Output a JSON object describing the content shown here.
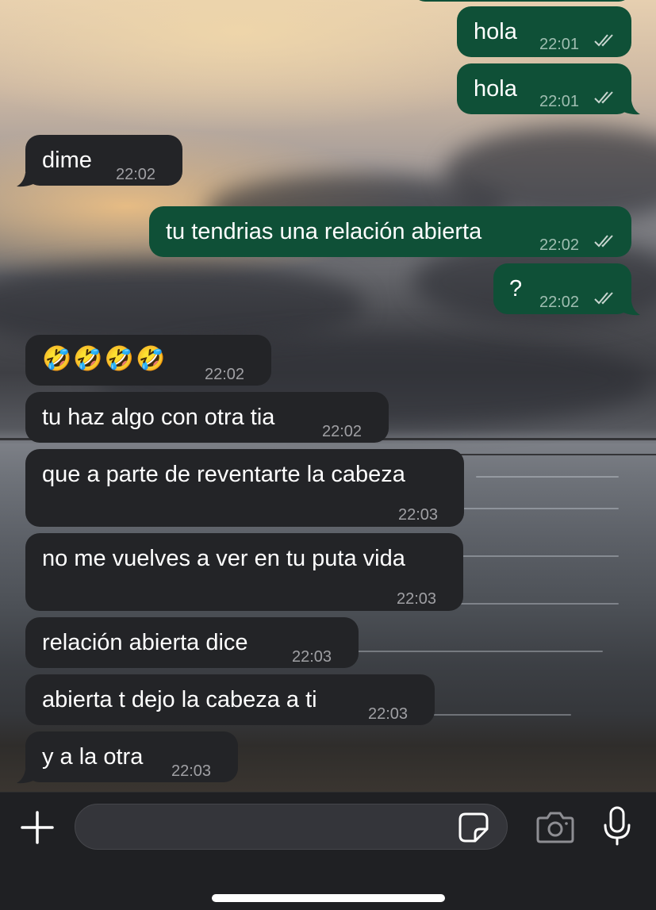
{
  "chat": {
    "messages": [
      {
        "direction": "out",
        "text": "hola",
        "time": "22:01",
        "status": "read"
      },
      {
        "direction": "out",
        "text": "hola",
        "time": "22:01",
        "status": "read"
      },
      {
        "direction": "in",
        "text": "dime",
        "time": "22:02"
      },
      {
        "direction": "out",
        "text": "tu tendrias una relación abierta",
        "time": "22:02",
        "status": "read"
      },
      {
        "direction": "out",
        "text": "?",
        "time": "22:02",
        "status": "read"
      },
      {
        "direction": "in",
        "text": "🤣🤣🤣🤣",
        "time": "22:02"
      },
      {
        "direction": "in",
        "text": "tu haz algo con otra tia",
        "time": "22:02"
      },
      {
        "direction": "in",
        "text": "que a parte de reventarte la cabeza",
        "time": "22:03"
      },
      {
        "direction": "in",
        "text": "no me vuelves a ver en tu puta vida",
        "time": "22:03"
      },
      {
        "direction": "in",
        "text": "relación abierta dice",
        "time": "22:03"
      },
      {
        "direction": "in",
        "text": "abierta t dejo la cabeza a ti",
        "time": "22:03"
      },
      {
        "direction": "in",
        "text": "y a la otra",
        "time": "22:03"
      }
    ]
  },
  "composer": {
    "placeholder": "",
    "icons": [
      "plus-icon",
      "sticker-icon",
      "camera-icon",
      "mic-icon"
    ]
  },
  "colors": {
    "outgoing_bubble": "#0f5037",
    "incoming_bubble": "#232427",
    "composer_bg": "#1f2023"
  }
}
